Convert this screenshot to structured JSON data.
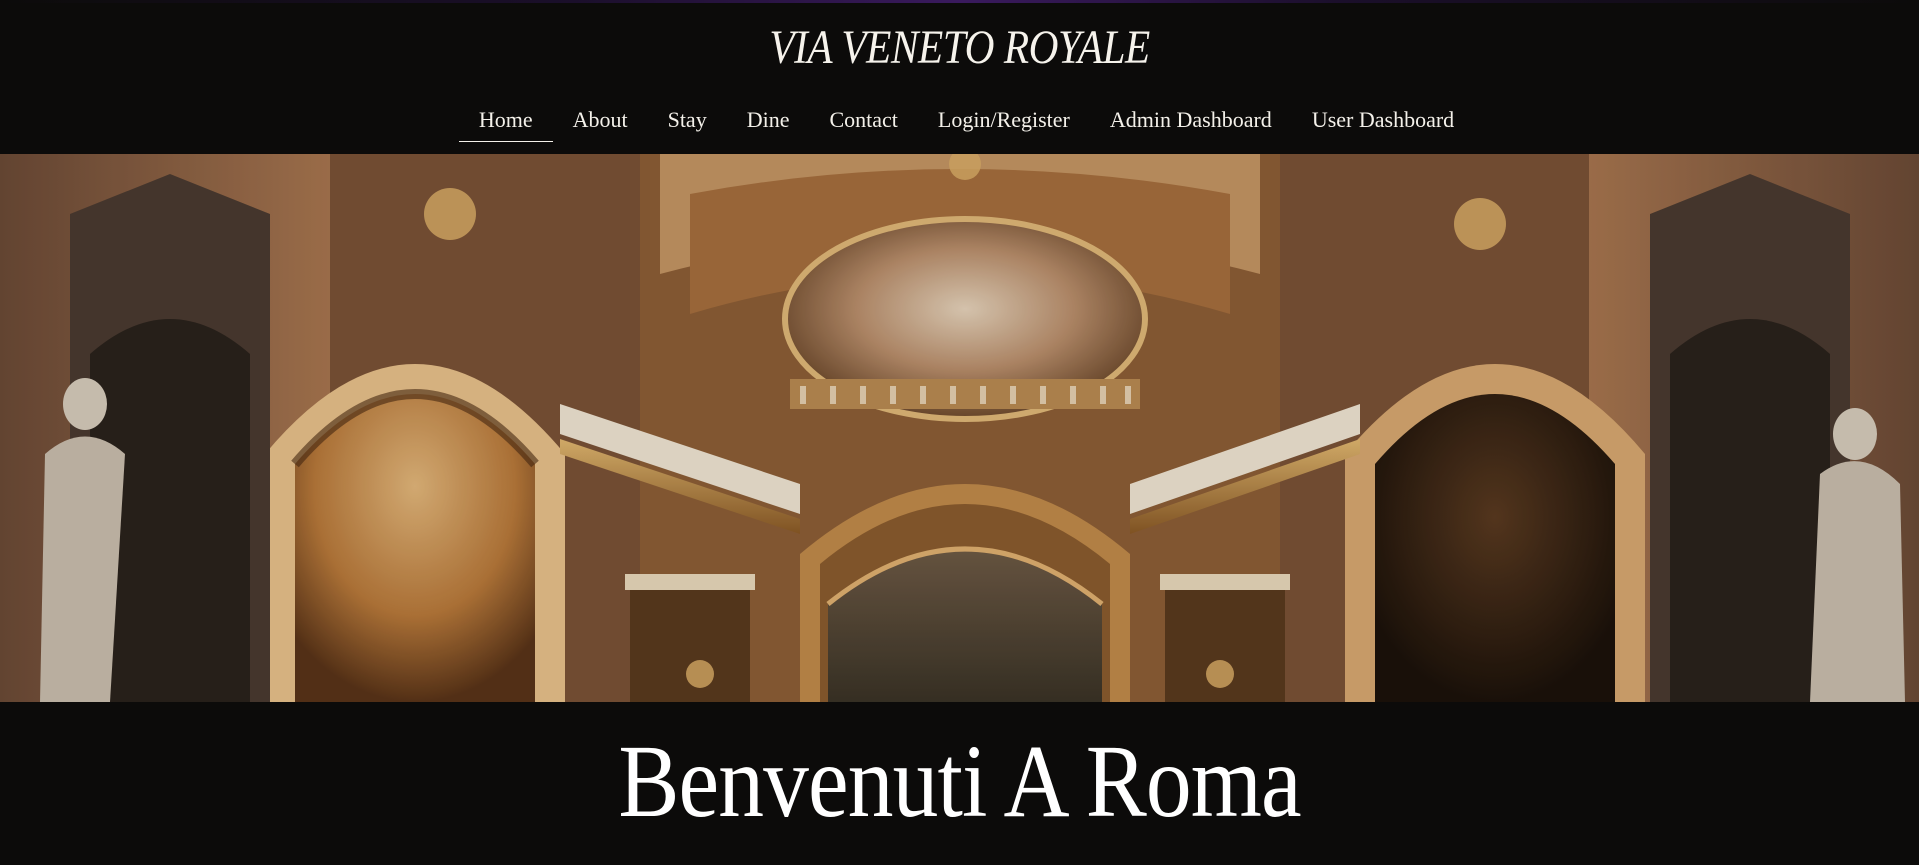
{
  "site": {
    "brand": "VIA VENETO ROYALE"
  },
  "nav": {
    "items": [
      {
        "label": "Home",
        "active": true
      },
      {
        "label": "About"
      },
      {
        "label": "Stay"
      },
      {
        "label": "Dine"
      },
      {
        "label": "Contact"
      },
      {
        "label": "Login/Register"
      },
      {
        "label": "Admin Dashboard"
      },
      {
        "label": "User Dashboard"
      }
    ]
  },
  "hero": {
    "image": "baroque-church-interior-photo"
  },
  "headline": "Benvenuti A Roma",
  "colors": {
    "background": "#0c0b0a",
    "text": "#f4f1ea",
    "accent": "#3a1a5e"
  }
}
